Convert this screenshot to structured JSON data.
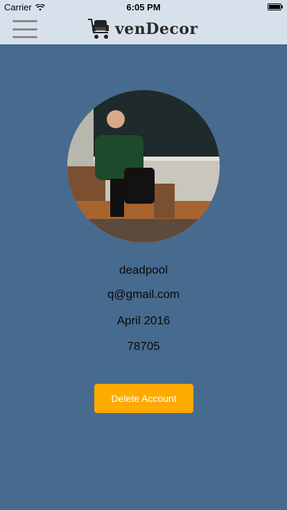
{
  "status_bar": {
    "carrier": "Carrier",
    "time": "6:05 PM"
  },
  "nav": {
    "title": "venDecor"
  },
  "profile": {
    "username": "deadpool",
    "email": "q@gmail.com",
    "member_since": "April 2016",
    "zip": "78705"
  },
  "actions": {
    "delete_label": "Delete Account"
  },
  "colors": {
    "background": "#476a8f",
    "nav_background": "#d7e1ec",
    "delete_button": "#ffaa00"
  }
}
